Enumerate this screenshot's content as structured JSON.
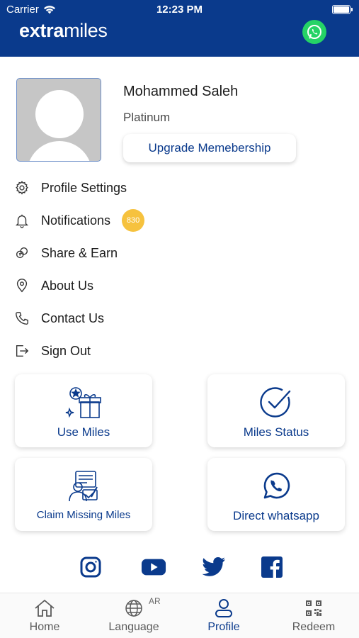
{
  "status_bar": {
    "carrier": "Carrier",
    "time": "12:23 PM"
  },
  "header": {
    "logo_bold": "extra",
    "logo_light": "miles",
    "whatsapp_icon": "whatsapp-icon",
    "background": "#0a3a8c"
  },
  "profile": {
    "name": "Mohammed Saleh",
    "tier": "Platinum",
    "upgrade_label": "Upgrade Memebership"
  },
  "menu": {
    "items": [
      {
        "label": "Profile Settings",
        "icon": "gear-icon"
      },
      {
        "label": "Notifications",
        "icon": "bell-icon",
        "badge": "830"
      },
      {
        "label": "Share & Earn",
        "icon": "share-earn-icon"
      },
      {
        "label": "About Us",
        "icon": "location-pin-icon"
      },
      {
        "label": "Contact Us",
        "icon": "phone-icon"
      },
      {
        "label": "Sign Out",
        "icon": "sign-out-icon"
      }
    ]
  },
  "cards": {
    "use_miles": "Use Miles",
    "miles_status": "Miles Status",
    "claim_missing": "Claim Missing Miles",
    "direct_whatsapp": "Direct whatsapp"
  },
  "social": [
    "instagram-icon",
    "youtube-icon",
    "twitter-icon",
    "facebook-icon"
  ],
  "tabbar": {
    "home": "Home",
    "language": "Language",
    "language_tag": "AR",
    "profile": "Profile",
    "redeem": "Redeem",
    "active": "Profile"
  },
  "colors": {
    "brand_blue": "#0a3a8c",
    "badge_yellow": "#f6c23e",
    "whatsapp_green": "#25d366"
  }
}
